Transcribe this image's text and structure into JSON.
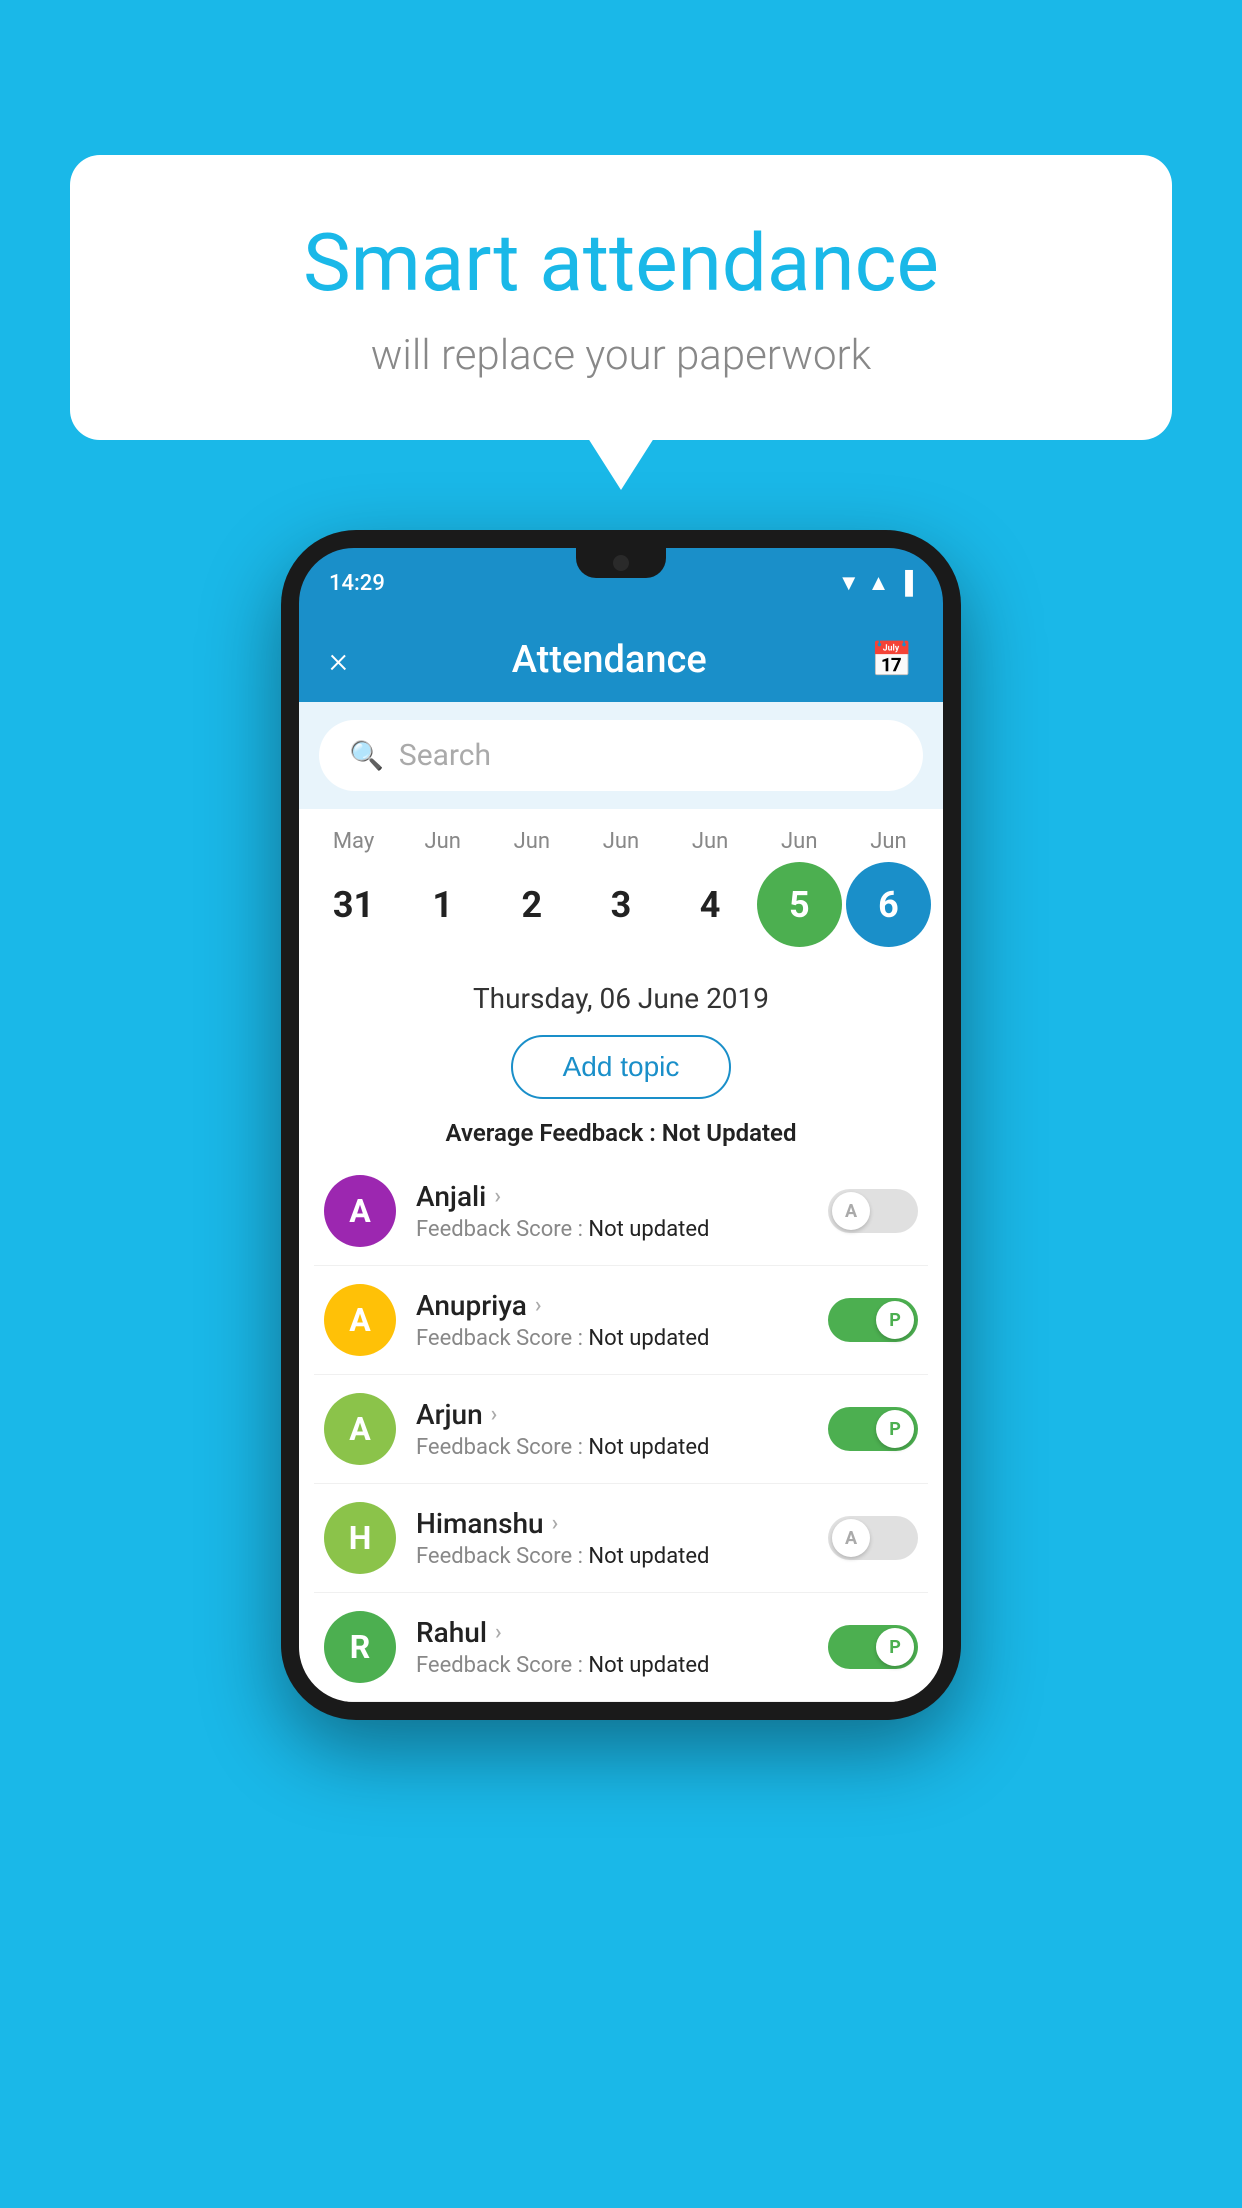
{
  "background_color": "#1ab8e8",
  "speech_bubble": {
    "title": "Smart attendance",
    "subtitle": "will replace your paperwork"
  },
  "status_bar": {
    "time": "14:29",
    "icons": [
      "wifi",
      "signal",
      "battery"
    ]
  },
  "header": {
    "close_label": "×",
    "title": "Attendance",
    "calendar_icon": "📅"
  },
  "search": {
    "placeholder": "Search"
  },
  "calendar": {
    "months": [
      "May",
      "Jun",
      "Jun",
      "Jun",
      "Jun",
      "Jun",
      "Jun"
    ],
    "dates": [
      "31",
      "1",
      "2",
      "3",
      "4",
      "5",
      "6"
    ],
    "today_index": 5,
    "selected_index": 6
  },
  "selected_date": "Thursday, 06 June 2019",
  "add_topic_label": "Add topic",
  "avg_feedback_label": "Average Feedback :",
  "avg_feedback_value": "Not Updated",
  "students": [
    {
      "name": "Anjali",
      "initial": "A",
      "avatar_color": "#9c27b0",
      "feedback_label": "Feedback Score :",
      "feedback_value": "Not updated",
      "status": "absent"
    },
    {
      "name": "Anupriya",
      "initial": "A",
      "avatar_color": "#ffc107",
      "feedback_label": "Feedback Score :",
      "feedback_value": "Not updated",
      "status": "present"
    },
    {
      "name": "Arjun",
      "initial": "A",
      "avatar_color": "#8bc34a",
      "feedback_label": "Feedback Score :",
      "feedback_value": "Not updated",
      "status": "present"
    },
    {
      "name": "Himanshu",
      "initial": "H",
      "avatar_color": "#8bc34a",
      "feedback_label": "Feedback Score :",
      "feedback_value": "Not updated",
      "status": "absent"
    },
    {
      "name": "Rahul",
      "initial": "R",
      "avatar_color": "#4caf50",
      "feedback_label": "Feedback Score :",
      "feedback_value": "Not updated",
      "status": "present"
    }
  ]
}
